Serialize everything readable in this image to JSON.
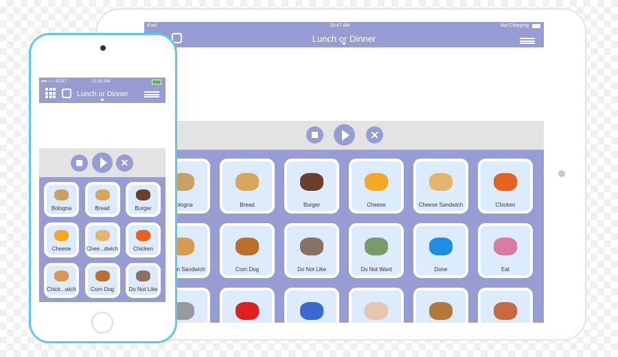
{
  "ipad": {
    "status": {
      "carrier": "iPad",
      "time": "10:47 AM",
      "battery": "Not Charging"
    },
    "title": "Lunch or Dinner",
    "tiles": [
      {
        "label": "Bologna",
        "icon": "sandwich",
        "color": "#c8a060"
      },
      {
        "label": "Bread",
        "icon": "bread",
        "color": "#d9a55a"
      },
      {
        "label": "Burger",
        "icon": "burger-patty",
        "color": "#6b3f2a"
      },
      {
        "label": "Cheese",
        "icon": "cheese",
        "color": "#f5a623"
      },
      {
        "label": "Cheese Sandwich",
        "icon": "bread",
        "color": "#e2b56a"
      },
      {
        "label": "Chicken",
        "icon": "chicken",
        "color": "#e8621e"
      },
      {
        "label": "Chicken Sandwich",
        "icon": "bun",
        "color": "#d99a4e"
      },
      {
        "label": "Corn Dog",
        "icon": "corn-dog",
        "color": "#b8702a"
      },
      {
        "label": "Do Not Like",
        "icon": "child-photo",
        "color": "#8a7060"
      },
      {
        "label": "Do Not Want",
        "icon": "child-photo",
        "color": "#7a9a6a"
      },
      {
        "label": "Done",
        "icon": "checkbox",
        "color": "#1e8fe0"
      },
      {
        "label": "Eat",
        "icon": "plate",
        "color": "#d97aa0"
      },
      {
        "label": "",
        "icon": "fork",
        "color": "#999999"
      },
      {
        "label": "",
        "icon": "fries",
        "color": "#e02020"
      },
      {
        "label": "",
        "icon": "box",
        "color": "#3a6ad0"
      },
      {
        "label": "",
        "icon": "plate",
        "color": "#e6c4b0"
      },
      {
        "label": "",
        "icon": "grilled-cheese",
        "color": "#b07a3a"
      },
      {
        "label": "",
        "icon": "hot-dog",
        "color": "#c86a40"
      }
    ]
  },
  "phone": {
    "status": {
      "carrier": "●●○○○ AT&T",
      "time": "10:50 AM"
    },
    "title": "Lunch or Dinner",
    "tiles": [
      {
        "label": "Bologna",
        "icon": "sandwich",
        "color": "#c8a060"
      },
      {
        "label": "Bread",
        "icon": "bread",
        "color": "#d9a55a"
      },
      {
        "label": "Burger",
        "icon": "burger-patty",
        "color": "#6b3f2a"
      },
      {
        "label": "Cheese",
        "icon": "cheese",
        "color": "#f5a623"
      },
      {
        "label": "Chee...dwich",
        "icon": "bread",
        "color": "#e2b56a"
      },
      {
        "label": "Chicken",
        "icon": "chicken",
        "color": "#e8621e"
      },
      {
        "label": "Chick...wich",
        "icon": "bun",
        "color": "#d99a4e"
      },
      {
        "label": "Corn Dog",
        "icon": "corn-dog",
        "color": "#b8702a"
      },
      {
        "label": "Do Not Like",
        "icon": "child-photo",
        "color": "#8a7060"
      }
    ]
  },
  "colors": {
    "accent": "#979dd2",
    "tile": "#dcebfd",
    "phone_frame": "#5cc8ea"
  }
}
